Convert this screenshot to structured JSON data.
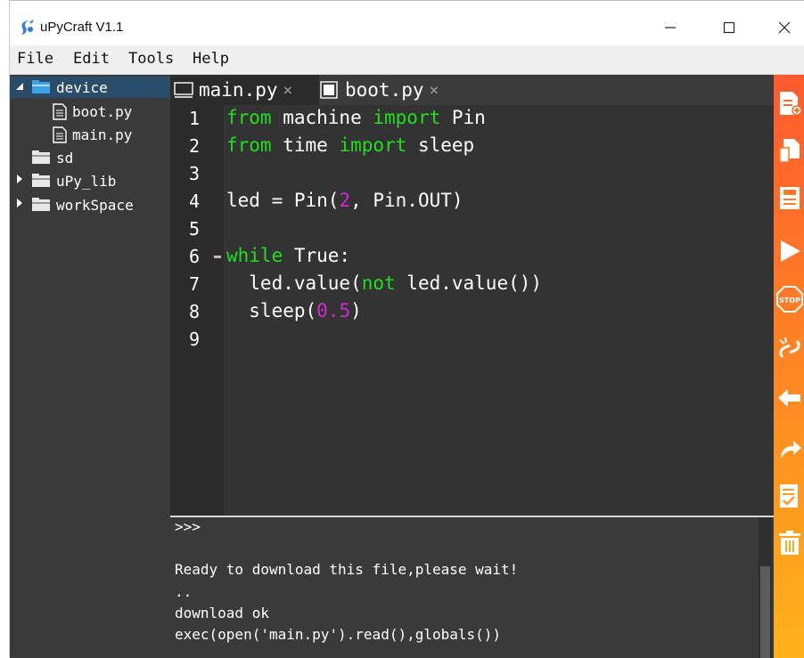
{
  "window": {
    "title": "uPyCraft V1.1"
  },
  "menu": [
    "File",
    "Edit",
    "Tools",
    "Help"
  ],
  "tree": {
    "root": "device",
    "device_files": [
      "boot.py",
      "main.py"
    ],
    "folders": [
      "sd",
      "uPy_lib",
      "workSpace"
    ]
  },
  "tabs": [
    {
      "label": "main.py",
      "close": "×",
      "active": true
    },
    {
      "label": "boot.py",
      "close": "×",
      "active": false
    }
  ],
  "line_numbers": [
    "1",
    "2",
    "3",
    "4",
    "5",
    "6",
    "7",
    "8",
    "9"
  ],
  "code": {
    "l1": {
      "kw1": "from",
      "t1": " machine ",
      "kw2": "import",
      "t2": " Pin"
    },
    "l2": {
      "kw1": "from",
      "t1": " time ",
      "kw2": "import",
      "t2": " sleep"
    },
    "l4": {
      "t1": "led = Pin(",
      "n1": "2",
      "t2": ", Pin.OUT)"
    },
    "l6": {
      "kw1": "while",
      "t1": " True:"
    },
    "l7": {
      "t1": "  led.value(",
      "kw1": "not",
      "t2": " led.value())"
    },
    "l8": {
      "t1": "  sleep(",
      "n1": "0.5",
      "t2": ")"
    }
  },
  "terminal": {
    "prompt": ">>>",
    "lines": [
      "Ready to download this file,please wait!",
      "..",
      "download ok",
      "exec(open('main.py').read(),globals())"
    ]
  },
  "colors": {
    "keyword": "#1ee01e",
    "number": "#d02cd0",
    "toolbar_top": "#ff5a2e",
    "toolbar_bottom": "#ffb21a",
    "tree_selection": "#294d68"
  },
  "toolbar_icons": [
    "new-file-icon",
    "open-file-icon",
    "save-icon",
    "run-icon",
    "stop-icon",
    "connect-icon",
    "undo-icon",
    "redo-icon",
    "syntax-check-icon",
    "clear-icon"
  ]
}
